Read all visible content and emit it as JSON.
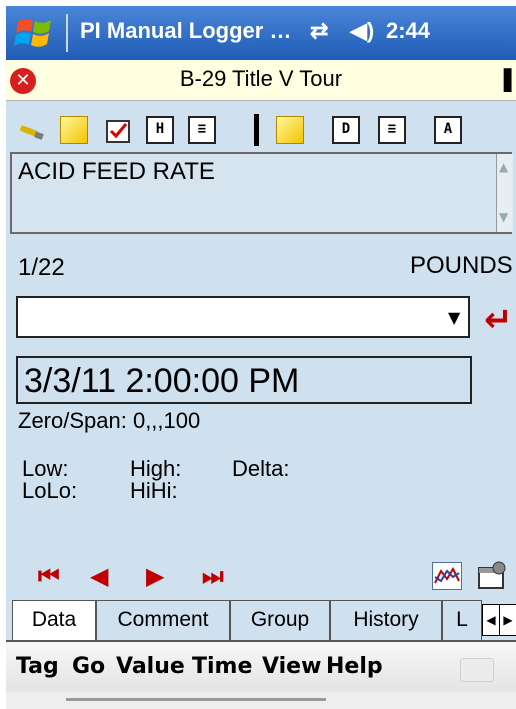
{
  "titlebar": {
    "title": "PI Manual Logger …",
    "sync_glyph": "⇄",
    "volume_glyph": "◀)",
    "clock": "2:44"
  },
  "tour": {
    "name": "B-29 Title V Tour",
    "close_glyph": "✕",
    "exit_glyph": "▐"
  },
  "tag": {
    "name": "ACID FEED RATE",
    "index": "1/22",
    "units": "POUNDS"
  },
  "value": {
    "current": "",
    "dropdown_glyph": "▼",
    "enter_glyph": "↵"
  },
  "time": {
    "value": "3/3/11 2:00:00 PM"
  },
  "limits": {
    "zero_span": "Zero/Span: 0,,,100",
    "low": "Low:",
    "high": "High:",
    "delta": "Delta:",
    "lolo": "LoLo:",
    "hihi": "HiHi:"
  },
  "nav": {
    "first": "⏮",
    "prev": "◀",
    "next": "▶",
    "last": "⏭"
  },
  "tabs": [
    "Data",
    "Comment",
    "Group",
    "History",
    "L"
  ],
  "tab_arrows": {
    "left": "◀",
    "right": "▶"
  },
  "menu": [
    "Tag",
    "Go",
    "Value",
    "Time",
    "View",
    "Help"
  ],
  "toolbar_docs": {
    "H": "H",
    "D": "D",
    "A": "A",
    "list": "≡"
  },
  "colors": {
    "accent": "#1f5cb5",
    "background": "#cfe0ee",
    "nav": "#c00000"
  }
}
